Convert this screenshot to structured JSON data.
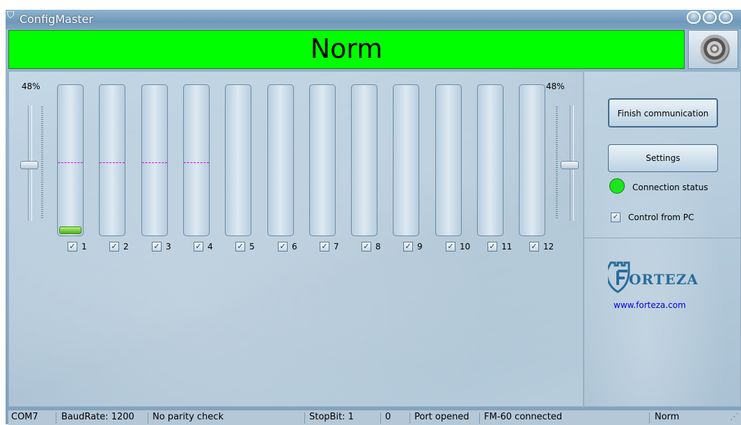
{
  "window": {
    "title": "ConfigMaster"
  },
  "banner": {
    "text": "Norm",
    "color": "#00ff00"
  },
  "sliders": {
    "left_value": "48%",
    "right_value": "48%",
    "level": 0.48
  },
  "channels": [
    {
      "label": "1",
      "checked": true,
      "fill": 0.05,
      "marker": 0.48
    },
    {
      "label": "2",
      "checked": true,
      "fill": 0,
      "marker": 0.48
    },
    {
      "label": "3",
      "checked": true,
      "fill": 0,
      "marker": 0.48
    },
    {
      "label": "4",
      "checked": true,
      "fill": 0,
      "marker": 0.48
    },
    {
      "label": "5",
      "checked": true,
      "fill": 0
    },
    {
      "label": "6",
      "checked": true,
      "fill": 0
    },
    {
      "label": "7",
      "checked": true,
      "fill": 0
    },
    {
      "label": "8",
      "checked": true,
      "fill": 0
    },
    {
      "label": "9",
      "checked": true,
      "fill": 0
    },
    {
      "label": "10",
      "checked": true,
      "fill": 0
    },
    {
      "label": "11",
      "checked": true,
      "fill": 0
    },
    {
      "label": "12",
      "checked": true,
      "fill": 0
    }
  ],
  "controls": {
    "finish_label": "Finish communication",
    "settings_label": "Settings",
    "connection_status_label": "Connection status",
    "connection_status_color": "#1ae81a",
    "control_from_pc_label": "Control from PC",
    "control_from_pc_checked": true
  },
  "brand": {
    "logo_text": "ORTEZA",
    "website": "www.forteza.com"
  },
  "statusbar": {
    "port": "COM7",
    "baud": "BaudRate: 1200",
    "parity": "No parity check",
    "stopbit": "StopBit: 1",
    "counter": "0",
    "port_state": "Port opened",
    "device": "FM-60 connected",
    "mode": "Norm"
  }
}
